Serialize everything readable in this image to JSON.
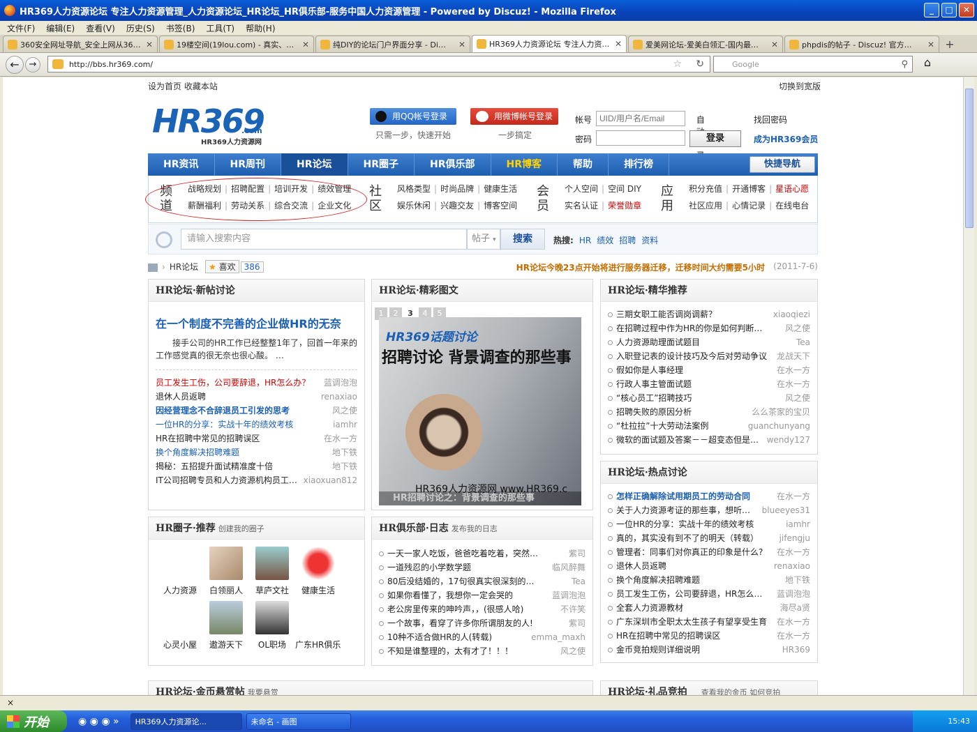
{
  "window": {
    "title": "HR369人力资源论坛 专注人力资源管理_人力资源论坛_HR论坛_HR俱乐部-服务中国人力资源管理 - Powered by Discuz! - Mozilla Firefox"
  },
  "menu": [
    "文件(F)",
    "编辑(E)",
    "查看(V)",
    "历史(S)",
    "书签(B)",
    "工具(T)",
    "帮助(H)"
  ],
  "tabs": [
    "360安全网址导航_安全上网从36…",
    "19楼空间(19lou.com) - 真实、…",
    "纯DIY的论坛门户界面分享 - Di…",
    "HR369人力资源论坛 专注人力资…",
    "爱美网论坛-爱美白领汇-国内最…",
    "phpdis的帖子 - Discuz! 官方…"
  ],
  "browser": {
    "url": "http://bbs.hr369.com/",
    "search_placeholder": "Google"
  },
  "site": {
    "top_left": "设为首页  收藏本站",
    "top_right": "切换到宽版",
    "logo_big": "HR369",
    "logo_com": ".com",
    "logo_sub": "HR369人力资源网",
    "qq_btn": "用QQ帐号登录",
    "qq_hint": "只需一步，快速开始",
    "weibo_btn": "用微博帐号登录",
    "weibo_hint": "一步搞定",
    "login": {
      "account_label": "帐号",
      "account_placeholder": "UID/用户名/Email",
      "password_label": "密码",
      "auto": "自动登录",
      "button": "登录",
      "forgot": "找回密码",
      "register": "成为HR369会员"
    },
    "nav": [
      "HR资讯",
      "HR周刊",
      "HR论坛",
      "HR圈子",
      "HR俱乐部",
      "HR博客",
      "帮助",
      "排行榜"
    ],
    "quick_nav": "快捷导航",
    "channel": {
      "label": "频道",
      "row1": [
        "战略规划",
        "招聘配置",
        "培训开发",
        "绩效管理"
      ],
      "row2": [
        "薪酬福利",
        "劳动关系",
        "综合交流",
        "企业文化"
      ]
    },
    "community": {
      "label": "社区",
      "row1": [
        "风格类型",
        "时尚品牌",
        "健康生活"
      ],
      "row2": [
        "娱乐休闲",
        "兴趣交友",
        "博客空间"
      ]
    },
    "member": {
      "label": "会员",
      "row1": [
        "个人空间",
        "空间 DIY"
      ],
      "row2": [
        "实名认证",
        "荣誉勋章"
      ]
    },
    "app": {
      "label": "应用",
      "row1": [
        "积分充值",
        "开通博客",
        "星语心愿"
      ],
      "row2": [
        "社区应用",
        "心情记录",
        "在线电台"
      ]
    },
    "search": {
      "placeholder": "请输入搜索内容",
      "type": "帖子",
      "button": "搜索",
      "hot_label": "热搜:",
      "hot": [
        "HR",
        "绩效",
        "招聘",
        "资料"
      ]
    },
    "crumb": {
      "name": "HR论坛",
      "like": "喜欢",
      "count": "386",
      "notice": "HR论坛今晚23点开始将进行服务器迁移，迁移时间大约需要5小时",
      "date": "(2011-7-6)"
    },
    "new_topics": {
      "title": "HR论坛·新帖讨论",
      "headline": "在一个制度不完善的企业做HR的无奈",
      "summary": "接手公司的HR工作已经整整1年了，回首一年来的工作感觉真的很无奈也很心酸。      …",
      "items": [
        {
          "t": "员工发生工伤，公司要辞退，HR怎么办？",
          "a": "蓝调泡泡"
        },
        {
          "t": "退休人员返聘",
          "a": "renaxiao"
        },
        {
          "t": "因经营理念不合辞退员工引发的思考",
          "a": "风之使"
        },
        {
          "t": "一位HR的分享：实战十年的绩效考核",
          "a": "iamhr"
        },
        {
          "t": "HR在招聘中常见的招聘误区",
          "a": "在水一方"
        },
        {
          "t": "换个角度解决招聘难题",
          "a": "地下铁"
        },
        {
          "t": "揭秘：五招提升面试精准度十倍",
          "a": "地下铁"
        },
        {
          "t": "IT公司招聘专员和人力资源机构员工服务专员",
          "a": "xiaoxuan812"
        }
      ]
    },
    "photos": {
      "title": "HR论坛·精彩图文",
      "pages": [
        "1",
        "2",
        "3",
        "4",
        "5"
      ],
      "caption_top": "HR369话题讨论",
      "caption_main": "招聘讨论 背景调查的那些事",
      "watermark": "HR369人力资源网 www.HR369.c",
      "bottom": "HR招聘讨论之：背景调查的那些事"
    },
    "featured": {
      "title": "HR论坛·精华推荐",
      "items": [
        {
          "t": "三期女职工能否调岗调薪？",
          "a": "xiaoqiezi"
        },
        {
          "t": "在招聘过程中作为HR的你是如何判断应聘者",
          "a": "风之使"
        },
        {
          "t": "人力资源助理面试题目",
          "a": "Tea"
        },
        {
          "t": "入职登记表的设计技巧及今后对劳动争议",
          "a": "龙战天下"
        },
        {
          "t": "假如你是人事经理",
          "a": "在水一方"
        },
        {
          "t": "行政人事主管面试题",
          "a": "在水一方"
        },
        {
          "t": "“核心员工”招聘技巧",
          "a": "风之使"
        },
        {
          "t": "招聘失败的原因分析",
          "a": "么么茶家的宝贝"
        },
        {
          "t": "“杜拉拉”十大劳动法案例",
          "a": "guanchunyang"
        },
        {
          "t": "微软的面试题及答案－－超变态但是很经",
          "a": "wendy127"
        }
      ]
    },
    "hot": {
      "title": "HR论坛·热点讨论",
      "items": [
        {
          "t": "怎样正确解除试用期员工的劳动合同",
          "a": "在水一方"
        },
        {
          "t": "关于人力资源考证的那些事，想听听大",
          "a": "blueeyes31"
        },
        {
          "t": "一位HR的分享：实战十年的绩效考核",
          "a": "iamhr"
        },
        {
          "t": "真的，其实没有到不了的明天（转载）",
          "a": "jifengju"
        },
        {
          "t": "管理者：同事们对你真正的印象是什么?",
          "a": "在水一方"
        },
        {
          "t": "退休人员返聘",
          "a": "renaxiao"
        },
        {
          "t": "换个角度解决招聘难题",
          "a": "地下铁"
        },
        {
          "t": "员工发生工伤，公司要辞退，HR怎么办？",
          "a": "蓝调泡泡"
        },
        {
          "t": "全套人力资源教材",
          "a": "海尽a贤"
        },
        {
          "t": "广东深圳市全职太太生孩子有望享受生育",
          "a": "在水一方"
        },
        {
          "t": "HR在招聘中常见的招聘误区",
          "a": "在水一方"
        },
        {
          "t": "金币竞拍规则详细说明",
          "a": "HR369"
        }
      ]
    },
    "circles": {
      "title": "HR圈子·推荐",
      "sub": "创建我的圈子",
      "items": [
        "人力资源",
        "白领丽人",
        "草庐文社",
        "健康生活",
        "心灵小屋",
        "遨游天下",
        "OL职场",
        "广东HR俱乐部"
      ]
    },
    "club": {
      "title": "HR俱乐部·日志",
      "sub": "发布我的日志",
      "items": [
        {
          "t": "一天一家人吃饭，爸爸吃着吃着，突然说：养",
          "a": "紫司"
        },
        {
          "t": "一道残忍的小学数学题",
          "a": "临风醉舞"
        },
        {
          "t": "80后没结婚的，17句很真实很深刻的话送给你",
          "a": "Tea"
        },
        {
          "t": "如果你看懂了，我想你一定会哭的",
          "a": "蓝调泡泡"
        },
        {
          "t": "老公房里传来的呻吟声，，(很感人哈)",
          "a": "不许笑"
        },
        {
          "t": "一个故事，看穿了许多你所谓朋友的人!",
          "a": "紫司"
        },
        {
          "t": "10种不适合做HR的人(转载)",
          "a": "emma_maxh"
        },
        {
          "t": "不知是谁整理的，太有才了！！！",
          "a": "风之使"
        }
      ]
    },
    "bottom_left": "HR论坛·金币悬赏帖",
    "bottom_left_sub": "我要悬赏",
    "bottom_right": "HR论坛·礼品竞拍",
    "bottom_right_sub": "查看我的金币 如何竞拍"
  },
  "statusbar": "×",
  "taskbar": {
    "start": "开始",
    "tasks": [
      "HR369人力资源论...",
      "未命名 - 画图"
    ],
    "clock": "15:43"
  }
}
